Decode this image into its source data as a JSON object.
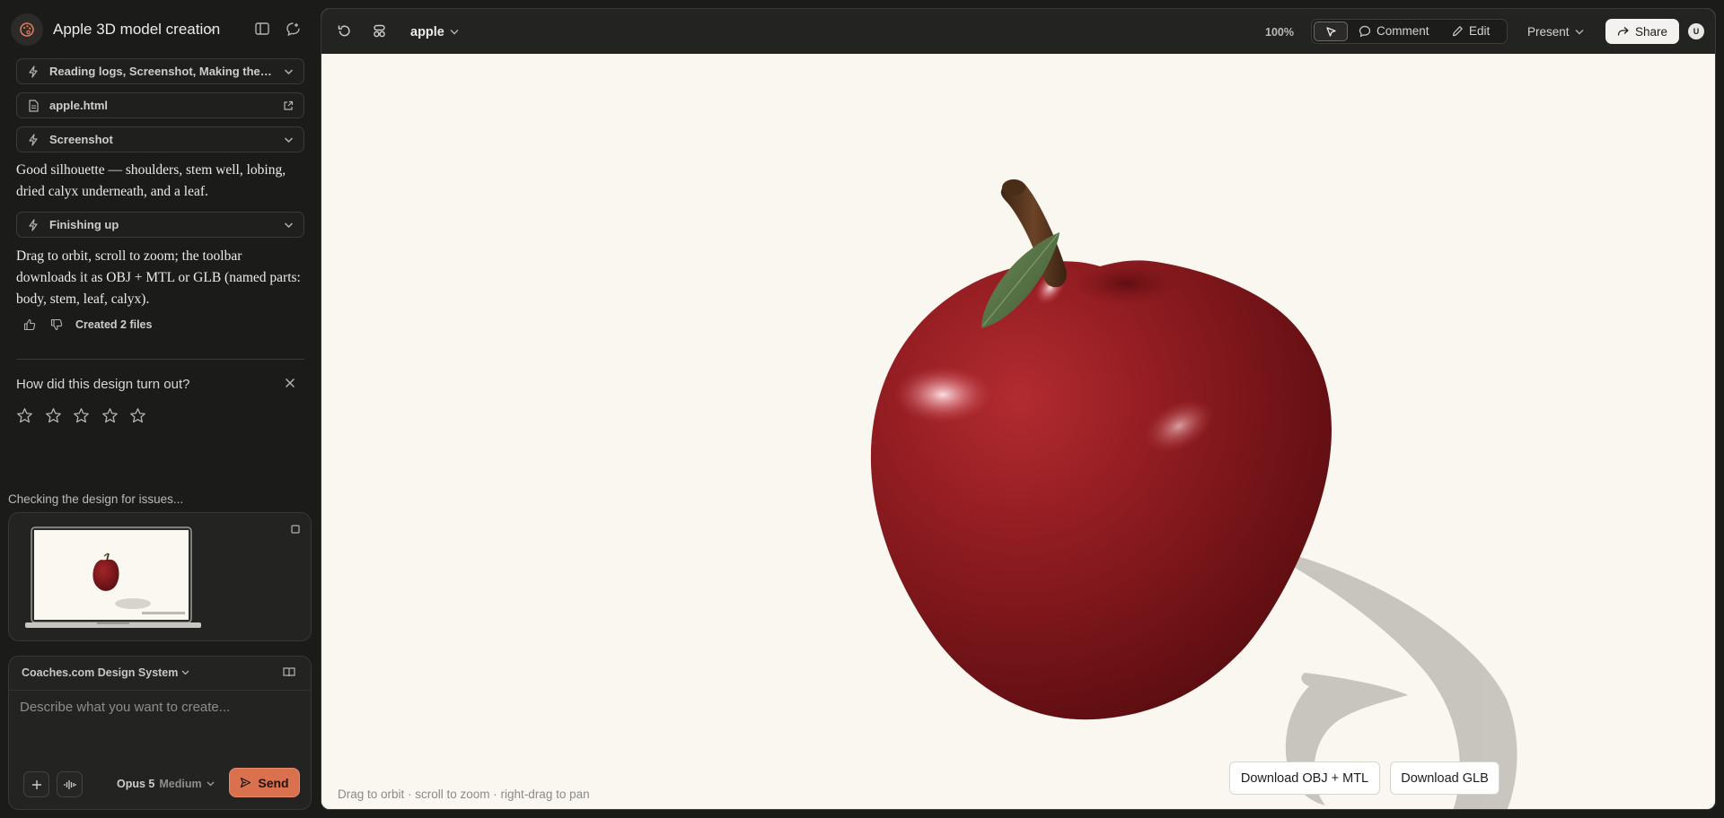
{
  "sidebar": {
    "project_title": "Apple 3D model creation",
    "steps": [
      {
        "label": "Reading logs, Screenshot, Making the app…",
        "icon": "bolt-icon"
      },
      {
        "label": "apple.html",
        "icon": "file-icon"
      },
      {
        "label": "Screenshot",
        "icon": "bolt-icon"
      },
      {
        "label": "Finishing up",
        "icon": "bolt-icon"
      }
    ],
    "message_1": "Good silhouette — shoulders, stem well, lobing, dried calyx underneath, and a leaf.",
    "message_2": "Drag to orbit, scroll to zoom; the toolbar downloads it as OBJ + MTL or GLB (named parts: body, stem, leaf, calyx).",
    "created_files": "Created 2 files",
    "rating_question": "How did this design turn out?",
    "rating_value": 0,
    "rating_max": 5,
    "checking_status": "Checking the design for issues..."
  },
  "composer": {
    "design_system": "Coaches.com Design System",
    "placeholder": "Describe what you want to create...",
    "model": "Opus 5",
    "effort": "Medium",
    "send_label": "Send"
  },
  "toolbar": {
    "file_name": "apple",
    "zoom": "100%",
    "comment_label": "Comment",
    "edit_label": "Edit",
    "present_label": "Present",
    "share_label": "Share",
    "avatar_initial": "U"
  },
  "canvas": {
    "hint": "Drag to orbit · scroll to zoom · right-drag to pan",
    "download_obj": "Download OBJ + MTL",
    "download_glb": "Download GLB"
  },
  "colors": {
    "accent": "#d9714f",
    "apple_red": "#8c1a1f",
    "canvas_bg": "#faf7f1",
    "app_bg": "#1b1b1a"
  }
}
